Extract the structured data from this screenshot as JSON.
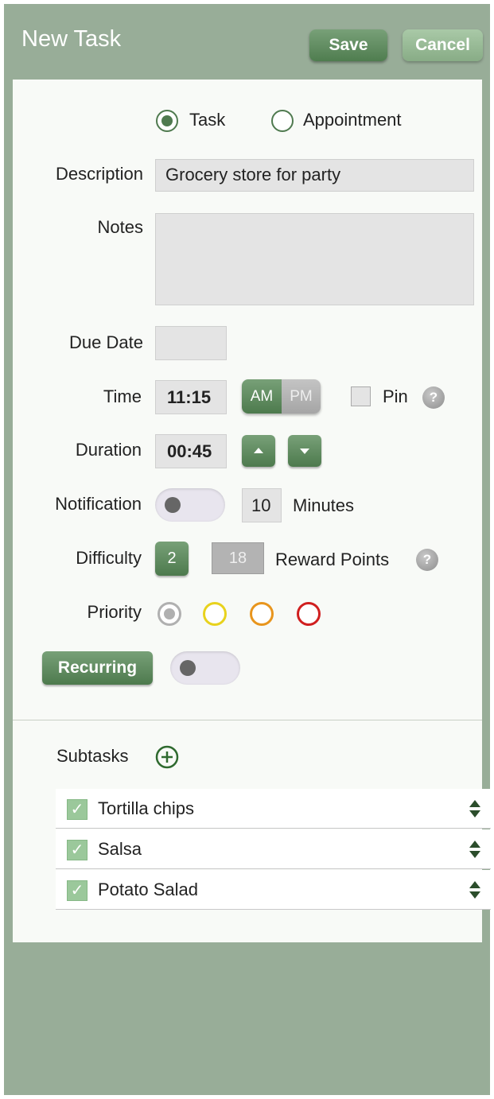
{
  "header": {
    "title": "New Task",
    "save_label": "Save",
    "cancel_label": "Cancel"
  },
  "type_options": {
    "task": "Task",
    "appointment": "Appointment",
    "selected": "Task"
  },
  "form": {
    "description_label": "Description",
    "description_value": "Grocery store for party",
    "notes_label": "Notes",
    "notes_value": "",
    "due_date_label": "Due Date",
    "due_date_value": "",
    "time_label": "Time",
    "time_value": "11:15",
    "am_label": "AM",
    "pm_label": "PM",
    "ampm_selected": "AM",
    "pin_label": "Pin",
    "pin_checked": false,
    "help_glyph": "?",
    "duration_label": "Duration",
    "duration_value": "00:45",
    "notification_label": "Notification",
    "notification_on": false,
    "notification_minutes": "10",
    "minutes_label": "Minutes",
    "difficulty_label": "Difficulty",
    "difficulty_value": "2",
    "reward_points_value": "18",
    "reward_points_label": "Reward Points",
    "priority_label": "Priority",
    "priority_colors": [
      "#b0b0b0",
      "#e8d21d",
      "#e8951d",
      "#d01f1f"
    ],
    "recurring_label": "Recurring",
    "recurring_on": false
  },
  "subtasks": {
    "label": "Subtasks",
    "items": [
      {
        "label": "Tortilla chips",
        "checked": true
      },
      {
        "label": "Salsa",
        "checked": true
      },
      {
        "label": "Potato Salad",
        "checked": true
      }
    ]
  },
  "colors": {
    "background": "#98ad98",
    "accent_green": "#4f7a4f",
    "panel": "#f8faf7"
  },
  "icons": [
    "plus-circle-icon",
    "help-icon",
    "sort-icon",
    "arrow-up-icon",
    "arrow-down-icon",
    "check-icon"
  ]
}
